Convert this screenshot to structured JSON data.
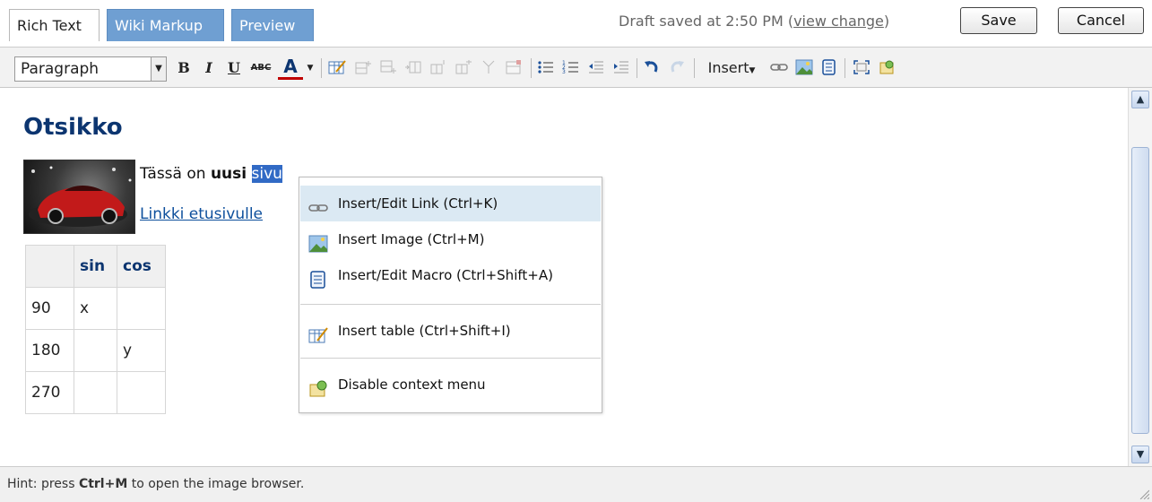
{
  "tabs": [
    {
      "label": "Rich Text",
      "active": true
    },
    {
      "label": "Wiki Markup",
      "active": false
    },
    {
      "label": "Preview",
      "active": false
    }
  ],
  "status": {
    "draft_text": "Draft saved at 2:50 PM",
    "view_change_label": "view change"
  },
  "buttons": {
    "save_label": "Save",
    "cancel_label": "Cancel"
  },
  "toolbar": {
    "paragraph_format": "Paragraph",
    "bold_label": "B",
    "italic_label": "I",
    "underline_label": "U",
    "strike_label": "ABC",
    "font_color_label": "A",
    "insert_label": "Insert",
    "icons": [
      "insert-table-icon",
      "insert-row-before-icon",
      "insert-row-after-icon",
      "insert-column-before-icon",
      "insert-column-after-icon",
      "delete-row-icon",
      "delete-column-icon",
      "table-properties-icon",
      "bulleted-list-icon",
      "numbered-list-icon",
      "outdent-icon",
      "indent-icon",
      "undo-icon",
      "redo-icon",
      "link-icon",
      "image-icon",
      "macro-icon",
      "fullscreen-icon",
      "settings-icon"
    ],
    "colors": {
      "toolbar_bg": "#f2f2f2",
      "font_color_underline": "#c00000",
      "tab_inactive": "#6f9fd2"
    }
  },
  "content": {
    "heading": "Otsikko",
    "paragraph_before": "Tässä on ",
    "paragraph_bold": "uusi",
    "paragraph_space": " ",
    "paragraph_selected": "sivu",
    "link_text": "Linkki etusivulle",
    "image_alt": "red sports car",
    "table": {
      "headers": [
        "",
        "sin",
        "cos"
      ],
      "rows": [
        [
          "90",
          "x",
          ""
        ],
        [
          "180",
          "",
          "y"
        ],
        [
          "270",
          "",
          ""
        ]
      ]
    }
  },
  "context_menu": {
    "items": [
      {
        "label": "Insert/Edit Link (Ctrl+K)",
        "icon": "link-icon",
        "highlighted": true
      },
      {
        "label": "Insert Image (Ctrl+M)",
        "icon": "image-icon",
        "highlighted": false
      },
      {
        "label": "Insert/Edit Macro (Ctrl+Shift+A)",
        "icon": "macro-icon",
        "highlighted": false
      },
      {
        "label": "Insert table (Ctrl+Shift+I)",
        "icon": "insert-table-icon",
        "highlighted": false
      },
      {
        "label": "Disable context menu",
        "icon": "disable-menu-icon",
        "highlighted": false
      }
    ]
  },
  "hint": {
    "prefix": "Hint: press ",
    "shortcut": "Ctrl+M",
    "suffix": " to open the image browser."
  }
}
